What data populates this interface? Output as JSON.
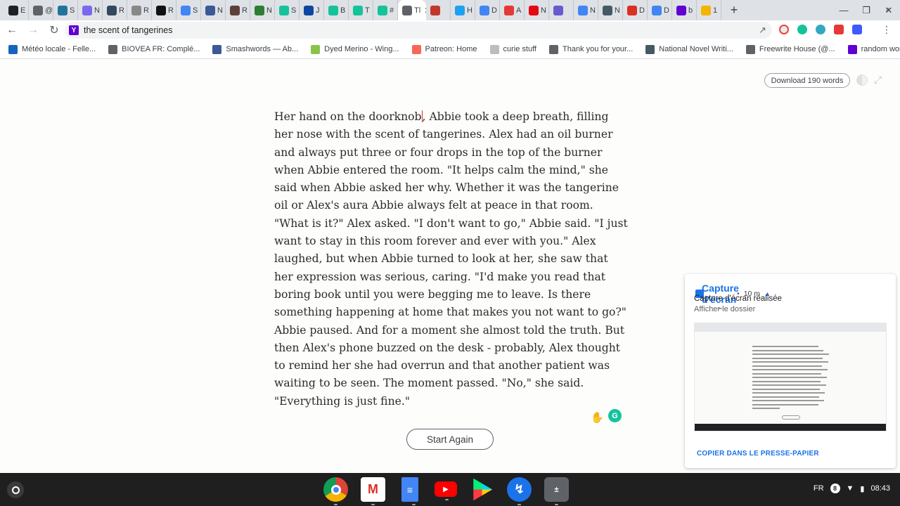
{
  "tabs": [
    {
      "letter": "E",
      "color": "#202124"
    },
    {
      "letter": "@",
      "color": "#5f6368"
    },
    {
      "letter": "S",
      "color": "#21759b"
    },
    {
      "letter": "N",
      "color": "#7b68ee"
    },
    {
      "letter": "R",
      "color": "#34495e"
    },
    {
      "letter": "R",
      "color": "#888888"
    },
    {
      "letter": "R",
      "color": "#111111"
    },
    {
      "letter": "S",
      "color": "#4285f4"
    },
    {
      "letter": "N",
      "color": "#3b5998"
    },
    {
      "letter": "R",
      "color": "#5d4037"
    },
    {
      "letter": "N",
      "color": "#2e7d32"
    },
    {
      "letter": "S",
      "color": "#15c39a"
    },
    {
      "letter": "J",
      "color": "#0d47a1"
    },
    {
      "letter": "B",
      "color": "#15c39a"
    },
    {
      "letter": "T",
      "color": "#15c39a"
    },
    {
      "letter": "#",
      "color": "#15c39a"
    }
  ],
  "active_tab": {
    "letter": "Tl",
    "color": "#ffffff"
  },
  "tabs_right": [
    {
      "letter": "",
      "color": "#c0392b"
    },
    {
      "letter": "H",
      "color": "#1da1f2"
    },
    {
      "letter": "D",
      "color": "#4285f4"
    },
    {
      "letter": "A",
      "color": "#e53935"
    },
    {
      "letter": "N",
      "color": "#e50914"
    },
    {
      "letter": "",
      "color": "#6a5acd"
    },
    {
      "letter": "N",
      "color": "#4285f4"
    },
    {
      "letter": "N",
      "color": "#455a64"
    },
    {
      "letter": "D",
      "color": "#d93025"
    },
    {
      "letter": "D",
      "color": "#4285f4"
    },
    {
      "letter": "b",
      "color": "#6001d2"
    },
    {
      "letter": "1",
      "color": "#f4b400"
    }
  ],
  "omnibox": {
    "search_engine_icon": "Y",
    "value": "the scent of tangerines"
  },
  "bookmarks": [
    {
      "label": "Météo locale - Felle...",
      "color": "#1565c0"
    },
    {
      "label": "BIOVEA FR: Complé...",
      "color": "#5f6368"
    },
    {
      "label": "Smashwords — Ab...",
      "color": "#3b5998"
    },
    {
      "label": "Dyed Merino - Wing...",
      "color": "#8bc34a"
    },
    {
      "label": "Patreon: Home",
      "color": "#f96854"
    },
    {
      "label": "curie stuff",
      "color": "#bdbdbd"
    },
    {
      "label": "Thank you for your...",
      "color": "#5f6368"
    },
    {
      "label": "National Novel Writi...",
      "color": "#455a64"
    },
    {
      "label": "Freewrite House (@...",
      "color": "#5f6368"
    },
    {
      "label": "random words - Ya...",
      "color": "#6001d2"
    }
  ],
  "page": {
    "download_label": "Download 190 words",
    "story_before_cursor": "Her hand on the doorknob",
    "story_after_cursor": ", Abbie took a deep breath, filling her nose with the scent of tangerines. Alex had an oil burner and always put three or four drops in the top of the burner when Abbie entered the room. \"It helps calm the mind,\" she said when Abbie asked her why. Whether it was the tangerine oil or Alex's aura Abbie always felt at peace in that room. \"What is it?\" Alex asked. \"I don't want to go,\" Abbie said. \"I just want to stay in this room forever and ever with you.\" Alex laughed, but when Abbie turned to look at her, she saw that her expression was serious, caring. \"I'd make you read that boring book until you were begging me to leave. Is there something happening at home that makes you not want to go?\" Abbie paused. And for a moment she almost told the truth. But then Alex's phone buzzed on the desk - probably, Alex thought to remind her she had overrun and that another patient was waiting to be seen. The moment passed. \"No,\" she said. \"Everything is just fine.\"",
    "start_again_label": "Start Again"
  },
  "notification": {
    "app": "Capture d'écran",
    "separator": "•",
    "time": "10 m",
    "title": "Capture d'écran réalisée",
    "subtitle": "Afficher le dossier",
    "action": "COPIER DANS LE PRESSE-PAPIER"
  },
  "shelf": {
    "language": "FR",
    "notification_count": "8",
    "clock": "08:43"
  }
}
